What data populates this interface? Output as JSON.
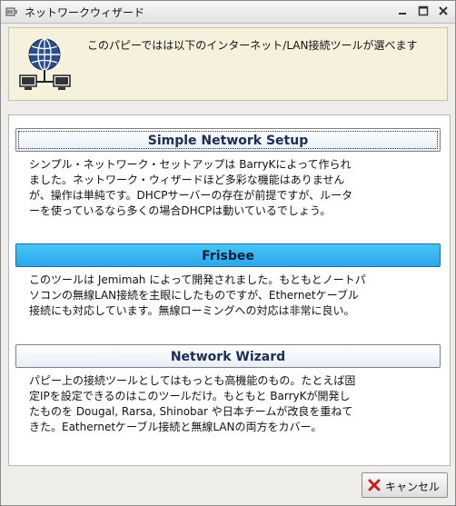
{
  "window": {
    "title": "ネットワークウィザード"
  },
  "header": {
    "text": "このパピーではは以下のインターネット/LAN接続ツールが選べます"
  },
  "options": [
    {
      "label": "Simple Network Setup",
      "description": "シンプル・ネットワーク・セットアップは BarryKによって作られ\nました。ネットワーク・ウィザードほど多彩な機能はありません\nが、操作は単純です。DHCPサーバーの存在が前提ですが、ルータ\nーを使っているなら多くの場合DHCPは動いているでしょう。"
    },
    {
      "label": "Frisbee",
      "description": "このツールは Jemimah によって開発されました。もともとノートパ\nソコンの無線LAN接続を主眼にしたものですが、Ethernetケーブル\n接続にも対応しています。無線ローミングへの対応は非常に良い。"
    },
    {
      "label": "Network Wizard",
      "description": "パピー上の接続ツールとしてはもっとも高機能のもの。たとえば固\n定IPを設定できるのはこのツールだけ。もともと BarryKが開発し\nたものを  Dougal, Rarsa, Shinobar や日本チームが改良を重ねて\nきた。Eathernetケーブル接続と無線LANの両方をカバー。"
    }
  ],
  "footer": {
    "cancel_label": "キャンセル"
  },
  "colors": {
    "header_bg": "#f5f1dc",
    "active_button": "#2aa8ea"
  }
}
